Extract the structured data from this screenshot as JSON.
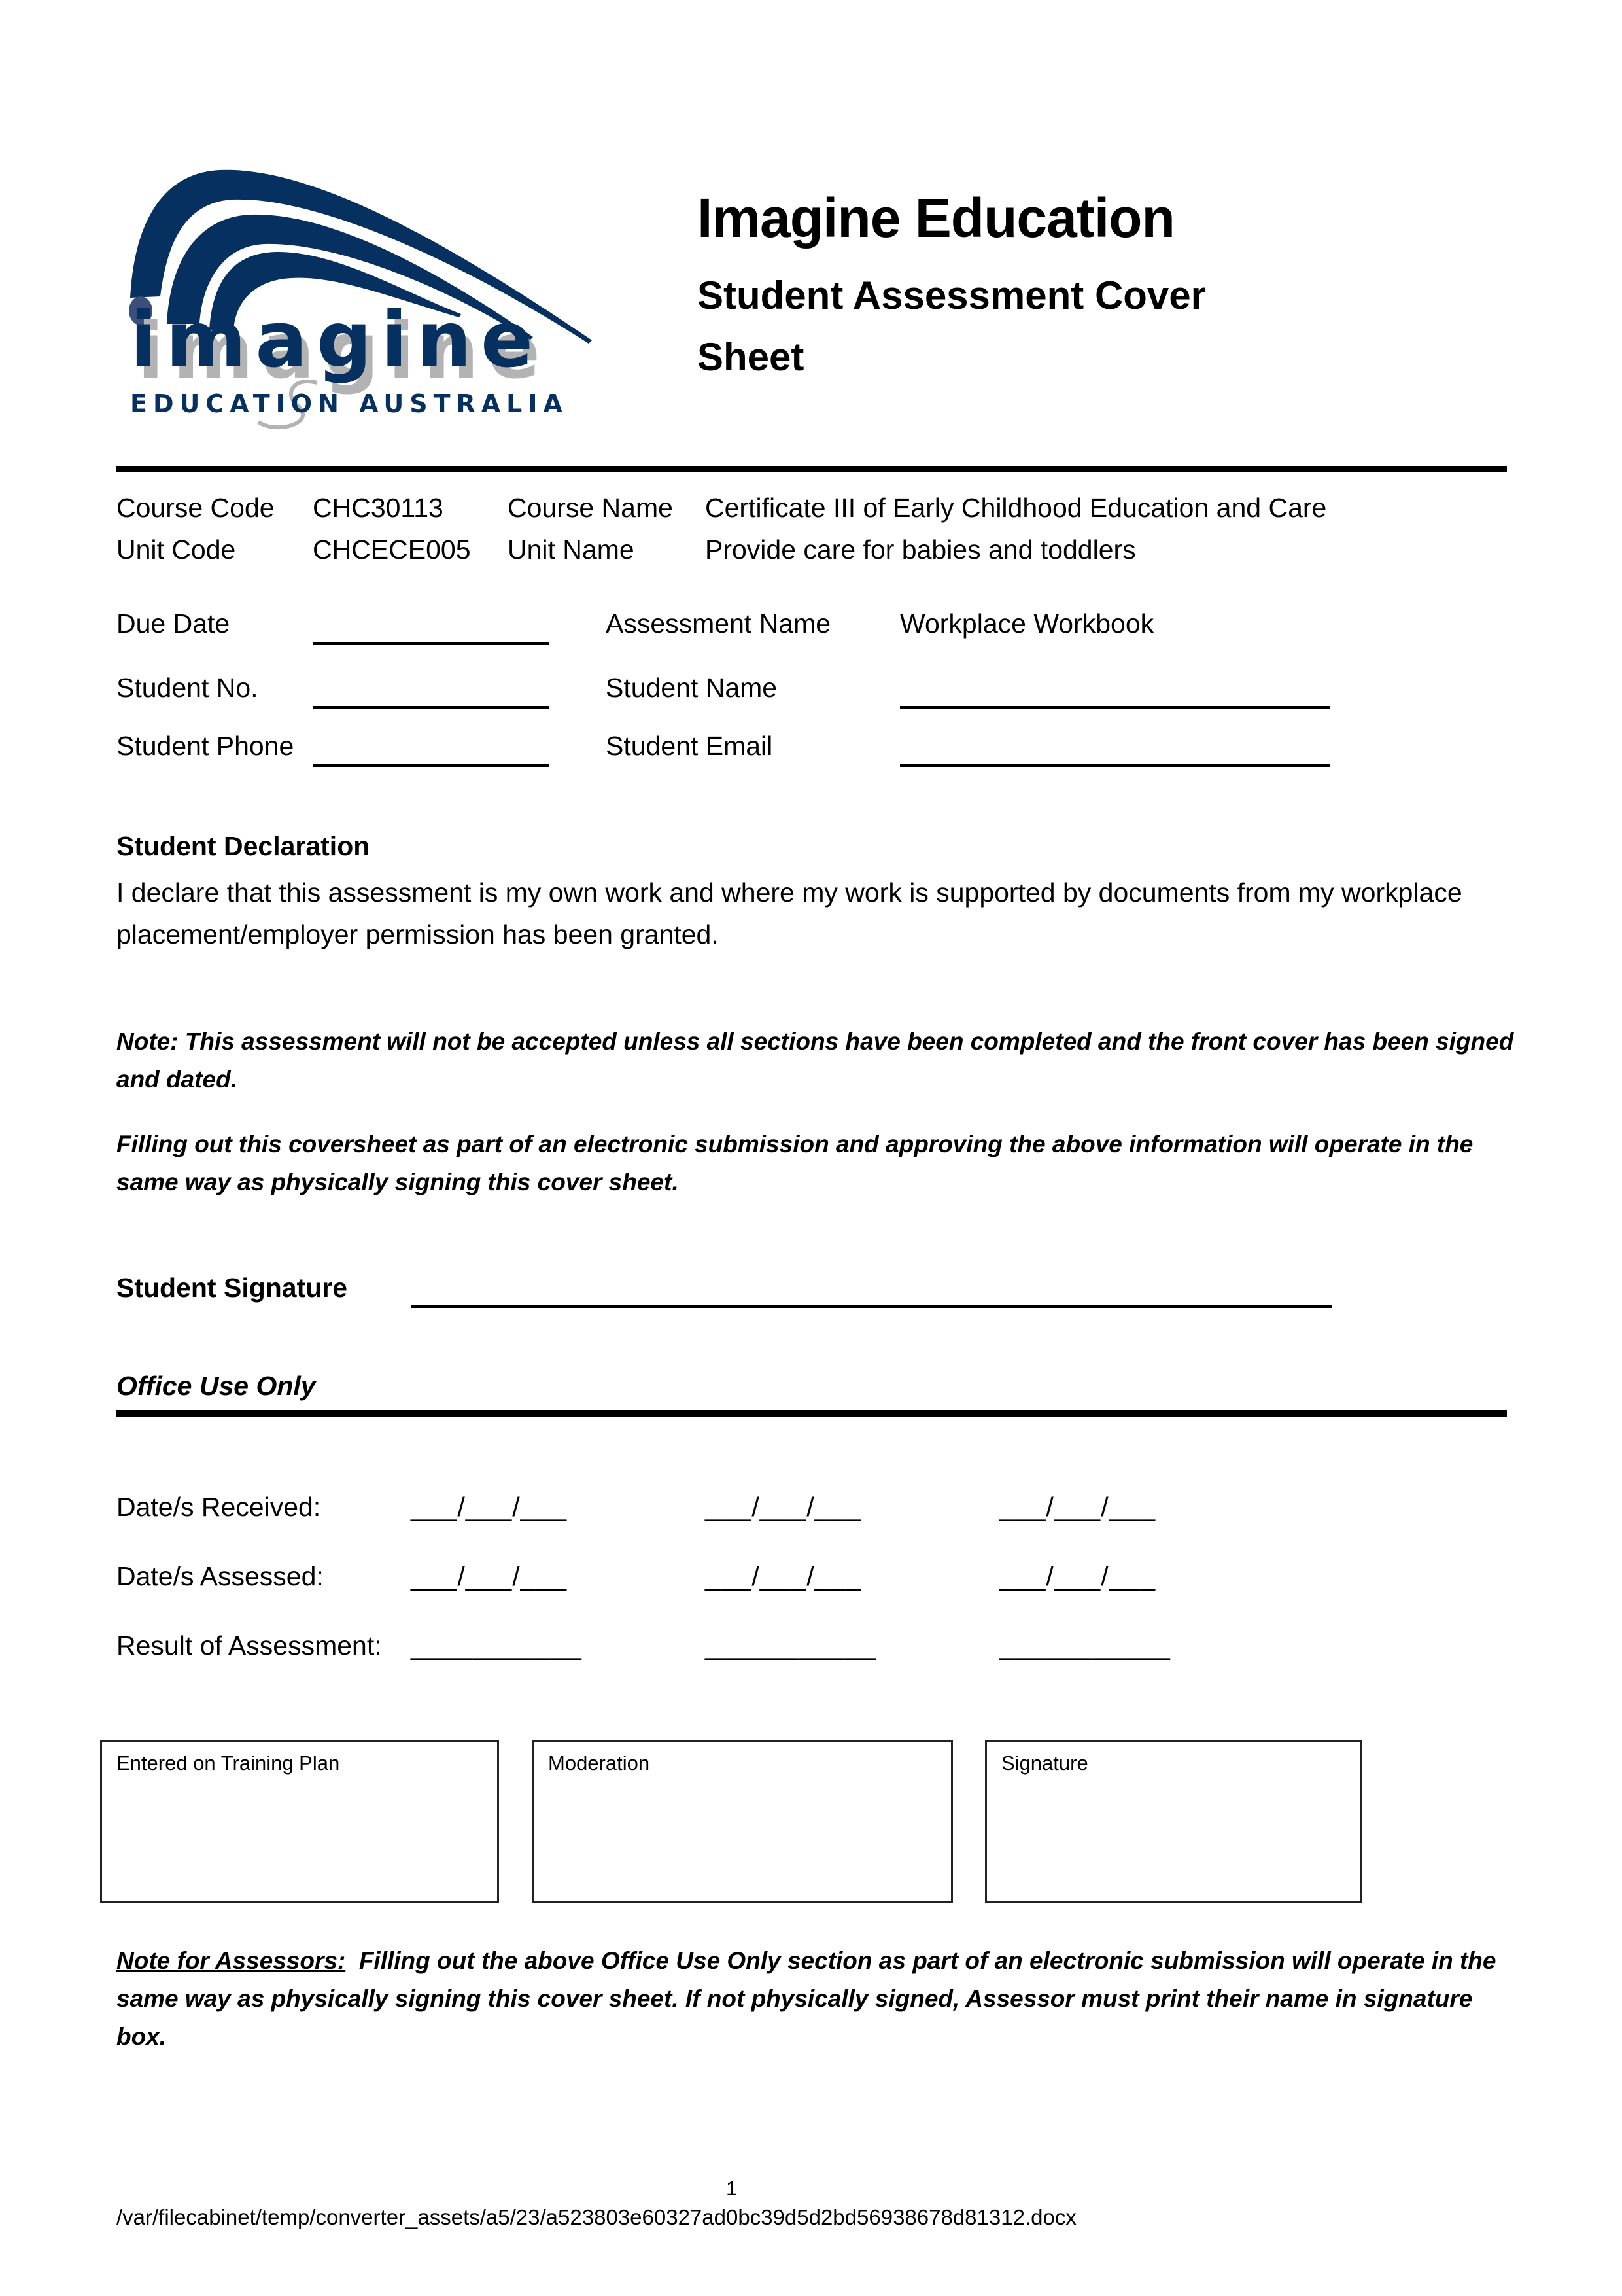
{
  "header": {
    "logo": {
      "wordmark": "imagine",
      "tagline": "EDUCATION AUSTRALIA",
      "brand_color": "#06305f",
      "shadow_color": "#b3b3b3"
    },
    "title": "Imagine Education",
    "subtitle": "Student Assessment Cover Sheet"
  },
  "course_info": {
    "course_code_label": "Course Code",
    "course_code": "CHC30113",
    "course_name_label": "Course Name",
    "course_name": "Certificate III of Early Childhood Education and Care",
    "unit_code_label": "Unit Code",
    "unit_code": "CHCECE005",
    "unit_name_label": "Unit Name",
    "unit_name": "Provide care for babies and toddlers"
  },
  "student_fields": {
    "due_date_label": "Due Date",
    "due_date_value": "",
    "assessment_name_label": "Assessment Name",
    "assessment_name": "Workplace Workbook",
    "student_no_label": "Student No.",
    "student_no_value": "",
    "student_name_label": "Student Name",
    "student_name_value": "",
    "student_phone_label": "Student Phone",
    "student_phone_value": "",
    "student_email_label": "Student Email",
    "student_email_value": ""
  },
  "declaration": {
    "heading": "Student Declaration",
    "text": "I declare that this assessment is my own work and where my work is supported by documents from my workplace placement/employer permission has been granted."
  },
  "notes": {
    "note1": "Note: This assessment will not be accepted unless all sections have been completed and the front cover has been signed and dated.",
    "note2": "Filling out this coversheet as part of an electronic submission and approving the above information will operate in the same way as physically signing this cover sheet."
  },
  "signature": {
    "label": "Student Signature",
    "value": ""
  },
  "office_use": {
    "heading": "Office Use Only",
    "dates_received_label": "Date/s Received:",
    "dates_assessed_label": "Date/s Assessed:",
    "result_label": "Result of Assessment:",
    "date_placeholder": "___/___/___",
    "result_placeholder": "___________",
    "boxes": [
      {
        "label": "Entered on Training Plan"
      },
      {
        "label": "Moderation"
      },
      {
        "label": "Signature"
      }
    ]
  },
  "assessor_note": {
    "lead": "Note for Assessors:",
    "text": "Filling out the above Office Use Only section as part of an electronic submission will operate in the same way as physically signing this cover sheet. If not physically signed, Assessor must print their name in signature box."
  },
  "footer": {
    "page_number": "1",
    "file_path": "/var/filecabinet/temp/converter_assets/a5/23/a523803e60327ad0bc39d5d2bd56938678d81312.docx"
  }
}
